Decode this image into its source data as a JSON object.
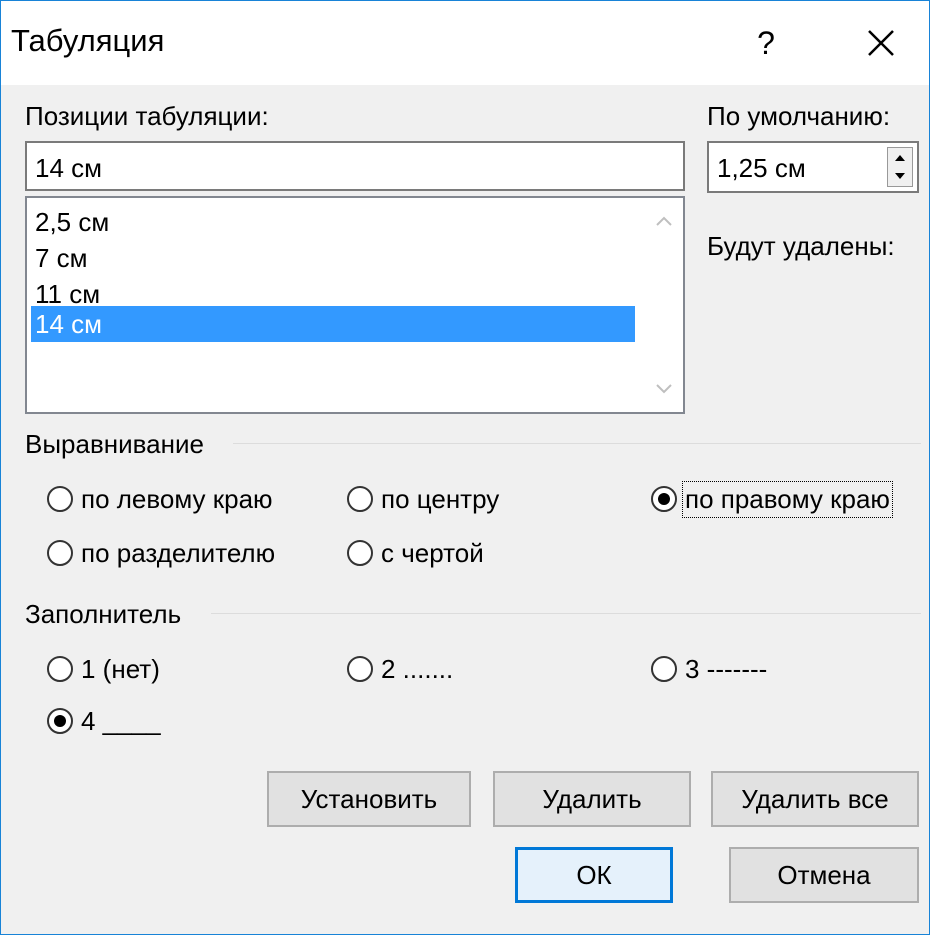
{
  "window": {
    "title": "Табуляция",
    "help_label": "?"
  },
  "tab_positions": {
    "label": "Позиции табуляции:",
    "value": "14 см",
    "items": [
      "2,5 см",
      "7 см",
      "11 см",
      "14 см"
    ],
    "selected_index": 3
  },
  "default_tabs": {
    "label": "По умолчанию:",
    "value": "1,25 см"
  },
  "to_be_cleared": {
    "label": "Будут удалены:"
  },
  "alignment": {
    "label": "Выравнивание",
    "options": [
      "по левому краю",
      "по центру",
      "по правому краю",
      "по разделителю",
      "с чертой"
    ],
    "selected": "по правому краю"
  },
  "leader": {
    "label": "Заполнитель",
    "options": [
      "1 (нет)",
      "2 .......",
      "3 -------",
      "4 ____"
    ],
    "selected": "4 ____"
  },
  "buttons": {
    "set": "Установить",
    "clear": "Удалить",
    "clear_all": "Удалить все",
    "ok": "ОК",
    "cancel": "Отмена"
  },
  "colors": {
    "selection": "#3399ff",
    "window_border": "#1883d7",
    "default_button_border": "#0078d7"
  }
}
